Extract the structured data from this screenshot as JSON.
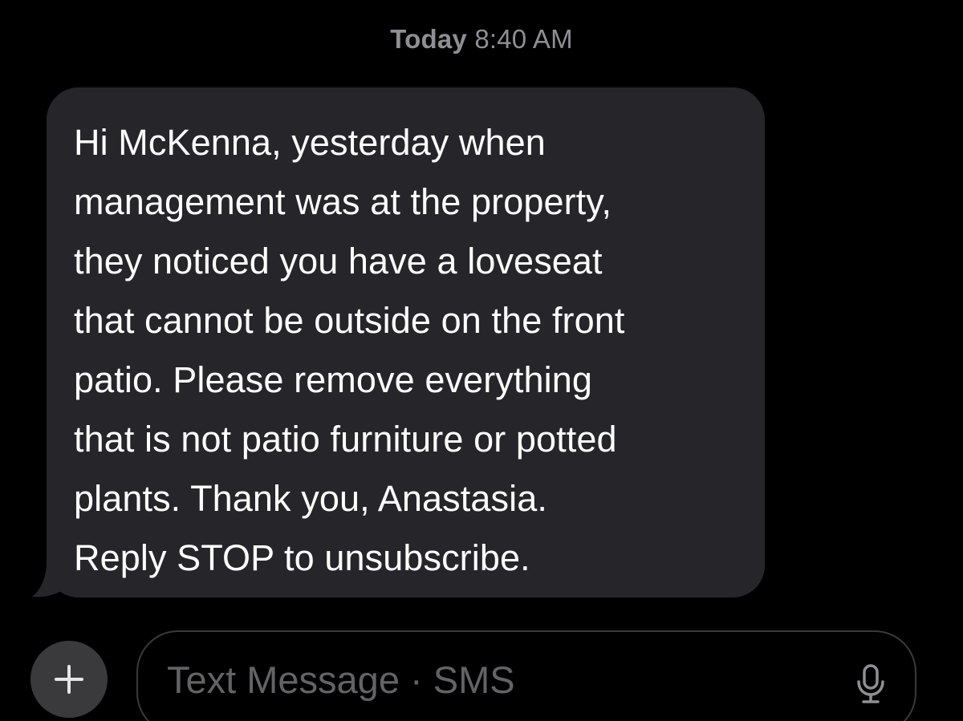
{
  "header": {
    "timestamp_day": "Today",
    "timestamp_time": "8:40 AM"
  },
  "message": {
    "direction": "incoming",
    "lines": [
      "Hi McKenna, yesterday when",
      "management was at the property,",
      "they noticed you have a loveseat",
      "that cannot be outside on the front",
      "patio. Please remove everything",
      "that is not patio furniture or potted",
      "plants. Thank you, Anastasia.",
      "Reply STOP to unsubscribe."
    ]
  },
  "composer": {
    "add_icon": "plus-icon",
    "placeholder": "Text Message · SMS",
    "mic_icon": "microphone-icon"
  },
  "colors": {
    "background": "#000000",
    "bubble": "#26252a",
    "timestamp": "#8e8e93",
    "message_text": "#ffffff",
    "placeholder": "#636366",
    "input_border": "#3a3a3c"
  }
}
